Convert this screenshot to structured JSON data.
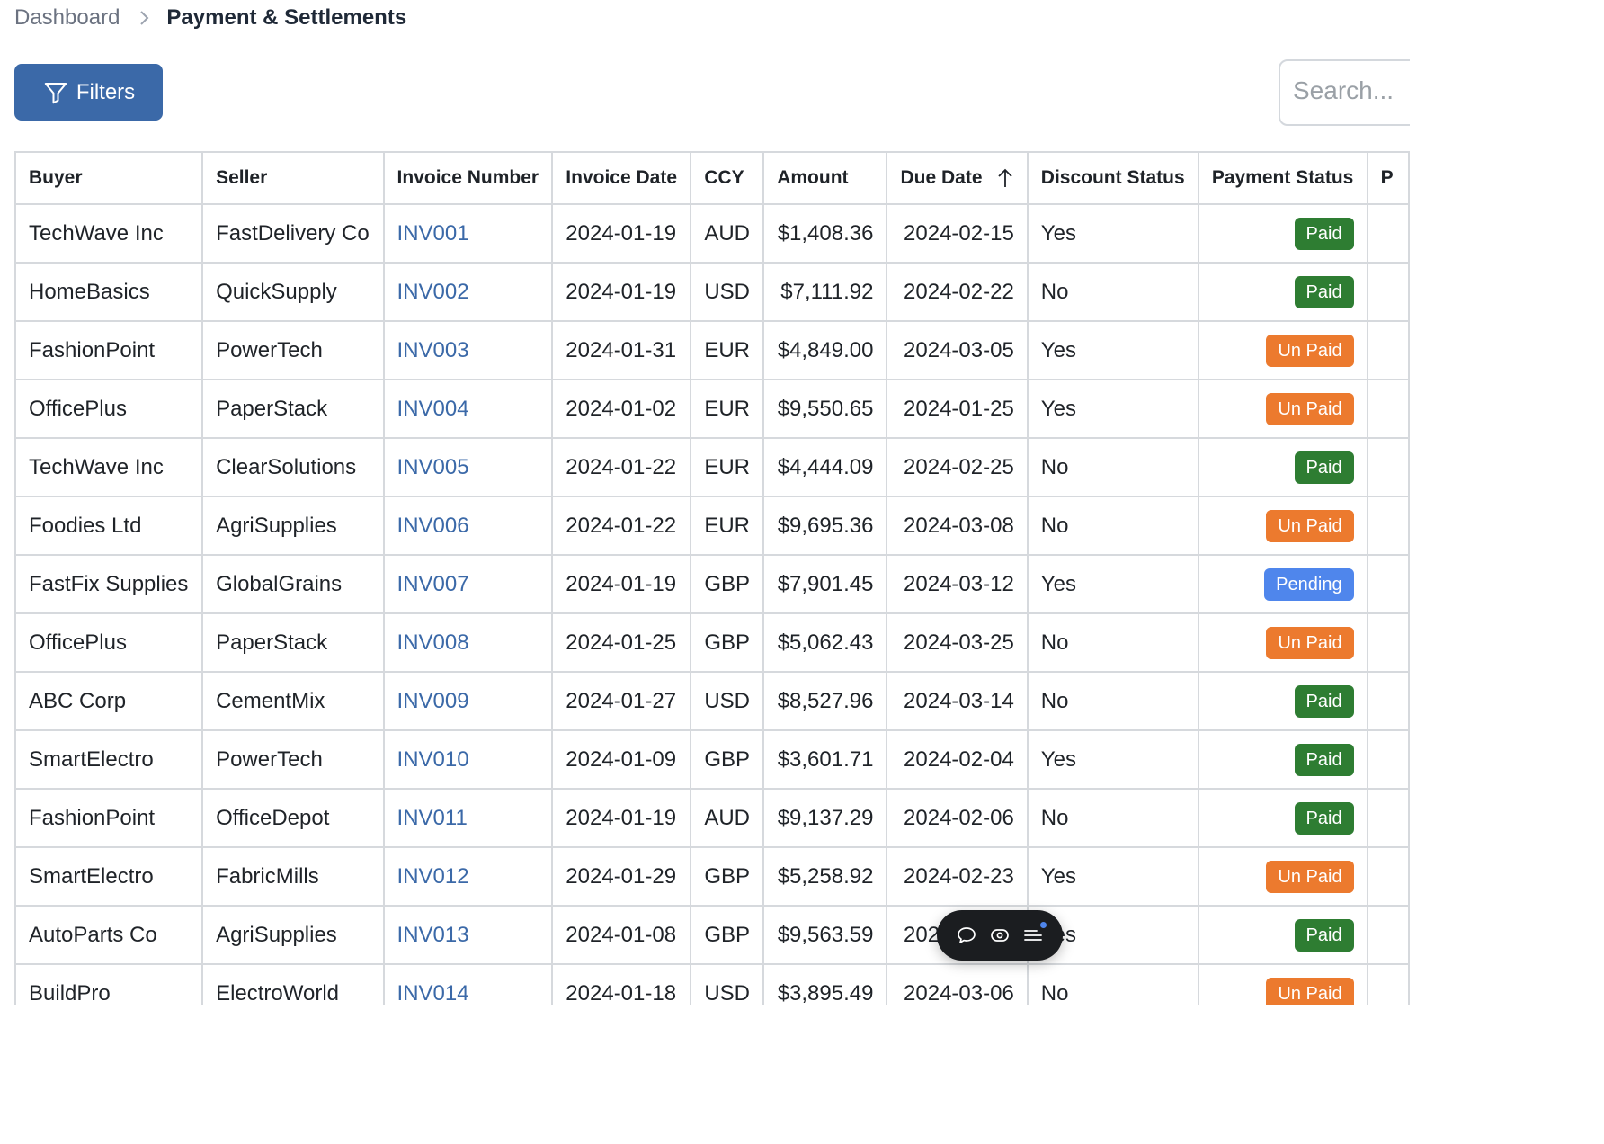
{
  "breadcrumb": {
    "parent": "Dashboard",
    "current": "Payment & Settlements"
  },
  "toolbar": {
    "filters_label": "Filters",
    "search_placeholder": "Search..."
  },
  "table": {
    "columns": [
      "Buyer",
      "Seller",
      "Invoice Number",
      "Invoice Date",
      "CCY",
      "Amount",
      "Due Date",
      "Discount Status",
      "Payment Status",
      "P"
    ],
    "sorted_column": "Due Date",
    "sort_direction": "ascending",
    "rows": [
      {
        "buyer": "TechWave Inc",
        "seller": "FastDelivery Co",
        "invoice": "INV001",
        "invoice_date": "2024-01-19",
        "ccy": "AUD",
        "amount": "$1,408.36",
        "due_date": "2024-02-15",
        "discount": "Yes",
        "payment": "Paid"
      },
      {
        "buyer": "HomeBasics",
        "seller": "QuickSupply",
        "invoice": "INV002",
        "invoice_date": "2024-01-19",
        "ccy": "USD",
        "amount": "$7,111.92",
        "due_date": "2024-02-22",
        "discount": "No",
        "payment": "Paid"
      },
      {
        "buyer": "FashionPoint",
        "seller": "PowerTech",
        "invoice": "INV003",
        "invoice_date": "2024-01-31",
        "ccy": "EUR",
        "amount": "$4,849.00",
        "due_date": "2024-03-05",
        "discount": "Yes",
        "payment": "Un Paid"
      },
      {
        "buyer": "OfficePlus",
        "seller": "PaperStack",
        "invoice": "INV004",
        "invoice_date": "2024-01-02",
        "ccy": "EUR",
        "amount": "$9,550.65",
        "due_date": "2024-01-25",
        "discount": "Yes",
        "payment": "Un Paid"
      },
      {
        "buyer": "TechWave Inc",
        "seller": "ClearSolutions",
        "invoice": "INV005",
        "invoice_date": "2024-01-22",
        "ccy": "EUR",
        "amount": "$4,444.09",
        "due_date": "2024-02-25",
        "discount": "No",
        "payment": "Paid"
      },
      {
        "buyer": "Foodies Ltd",
        "seller": "AgriSupplies",
        "invoice": "INV006",
        "invoice_date": "2024-01-22",
        "ccy": "EUR",
        "amount": "$9,695.36",
        "due_date": "2024-03-08",
        "discount": "No",
        "payment": "Un Paid"
      },
      {
        "buyer": "FastFix Supplies",
        "seller": "GlobalGrains",
        "invoice": "INV007",
        "invoice_date": "2024-01-19",
        "ccy": "GBP",
        "amount": "$7,901.45",
        "due_date": "2024-03-12",
        "discount": "Yes",
        "payment": "Pending"
      },
      {
        "buyer": "OfficePlus",
        "seller": "PaperStack",
        "invoice": "INV008",
        "invoice_date": "2024-01-25",
        "ccy": "GBP",
        "amount": "$5,062.43",
        "due_date": "2024-03-25",
        "discount": "No",
        "payment": "Un Paid"
      },
      {
        "buyer": "ABC Corp",
        "seller": "CementMix",
        "invoice": "INV009",
        "invoice_date": "2024-01-27",
        "ccy": "USD",
        "amount": "$8,527.96",
        "due_date": "2024-03-14",
        "discount": "No",
        "payment": "Paid"
      },
      {
        "buyer": "SmartElectro",
        "seller": "PowerTech",
        "invoice": "INV010",
        "invoice_date": "2024-01-09",
        "ccy": "GBP",
        "amount": "$3,601.71",
        "due_date": "2024-02-04",
        "discount": "Yes",
        "payment": "Paid"
      },
      {
        "buyer": "FashionPoint",
        "seller": "OfficeDepot",
        "invoice": "INV011",
        "invoice_date": "2024-01-19",
        "ccy": "AUD",
        "amount": "$9,137.29",
        "due_date": "2024-02-06",
        "discount": "No",
        "payment": "Paid"
      },
      {
        "buyer": "SmartElectro",
        "seller": "FabricMills",
        "invoice": "INV012",
        "invoice_date": "2024-01-29",
        "ccy": "GBP",
        "amount": "$5,258.92",
        "due_date": "2024-02-23",
        "discount": "Yes",
        "payment": "Un Paid"
      },
      {
        "buyer": "AutoParts Co",
        "seller": "AgriSupplies",
        "invoice": "INV013",
        "invoice_date": "2024-01-08",
        "ccy": "GBP",
        "amount": "$9,563.59",
        "due_date": "2024-03-01",
        "discount": "Yes",
        "payment": "Paid"
      },
      {
        "buyer": "BuildPro",
        "seller": "ElectroWorld",
        "invoice": "INV014",
        "invoice_date": "2024-01-18",
        "ccy": "USD",
        "amount": "$3,895.49",
        "due_date": "2024-03-06",
        "discount": "No",
        "payment": "Un Paid"
      }
    ]
  },
  "status_colors": {
    "Paid": "#2e7d32",
    "Un Paid": "#ec7a2e",
    "Pending": "#4f86ec"
  },
  "floating_toolbar": {
    "icons": [
      "comment-icon",
      "eye-icon",
      "menu-icon"
    ]
  }
}
